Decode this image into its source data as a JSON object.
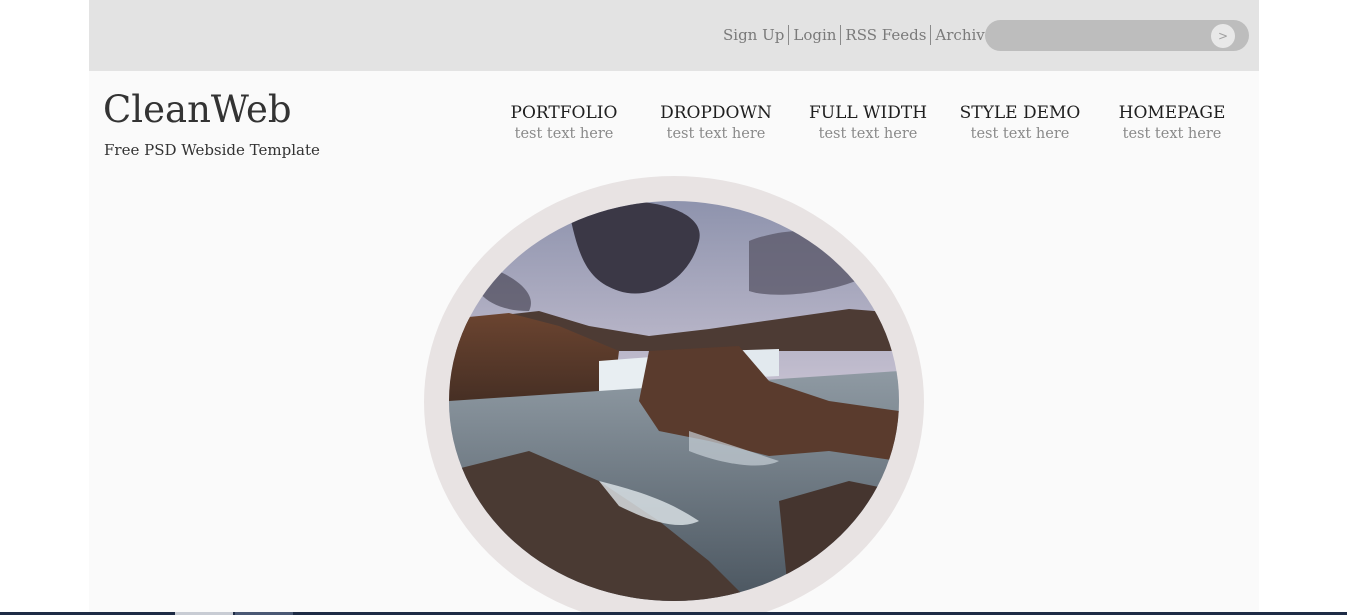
{
  "header": {
    "links": [
      {
        "label": "Sign Up"
      },
      {
        "label": "Login"
      },
      {
        "label": "RSS Feeds"
      },
      {
        "label": "Archives"
      }
    ],
    "search": {
      "placeholder": "",
      "button_label": ">"
    }
  },
  "brand": {
    "logo": "CleanWeb",
    "tagline": "Free PSD Webside Template"
  },
  "nav": {
    "items": [
      {
        "title": "PORTFOLIO",
        "subtitle": "test text here"
      },
      {
        "title": "DROPDOWN",
        "subtitle": "test text here"
      },
      {
        "title": "FULL WIDTH",
        "subtitle": "test text here"
      },
      {
        "title": "STYLE DEMO",
        "subtitle": "test text here"
      },
      {
        "title": "HOMEPAGE",
        "subtitle": "test text here"
      }
    ]
  },
  "hero": {
    "image": "waterfall-landscape-photo"
  },
  "colors": {
    "topbar": "#e3e3e3",
    "page": "#fafafa",
    "ring": "#e8e3e3",
    "text": "#333333",
    "muted": "#8a8a8a"
  }
}
